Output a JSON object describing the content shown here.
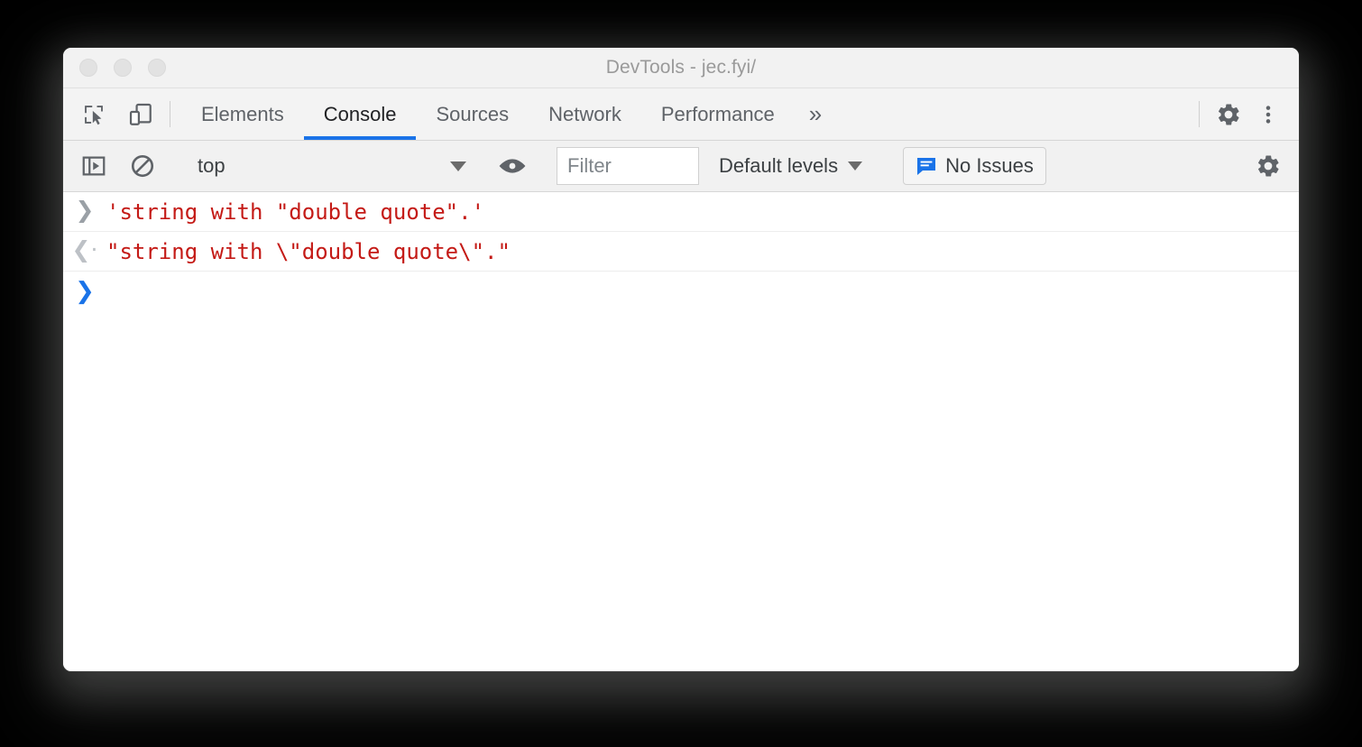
{
  "window": {
    "title": "DevTools - jec.fyi/",
    "traffic_lights": [
      "close",
      "minimize",
      "maximize"
    ]
  },
  "tabbar": {
    "left_icons": [
      {
        "name": "inspect-element-icon",
        "label": "Inspect element"
      },
      {
        "name": "device-toolbar-icon",
        "label": "Toggle device toolbar"
      }
    ],
    "tabs": [
      {
        "label": "Elements",
        "active": false
      },
      {
        "label": "Console",
        "active": true
      },
      {
        "label": "Sources",
        "active": false
      },
      {
        "label": "Network",
        "active": false
      },
      {
        "label": "Performance",
        "active": false
      }
    ],
    "more_tabs_glyph": "»",
    "right_icons": [
      {
        "name": "settings-gear-icon",
        "label": "Settings"
      },
      {
        "name": "more-options-icon",
        "label": "Customize and control DevTools"
      }
    ],
    "active_tab_color": "#1a73e8"
  },
  "console_toolbar": {
    "sidebar_toggle_label": "Show console sidebar",
    "clear_console_label": "Clear console",
    "context": {
      "selected": "top",
      "options": [
        "top"
      ]
    },
    "eye_icon_label": "Create live expression",
    "filter": {
      "value": "",
      "placeholder": "Filter"
    },
    "levels": {
      "selected": "Default levels",
      "caret": "▼"
    },
    "issues": {
      "label": "No Issues",
      "icon": "issues-speech-bubble-icon",
      "icon_color": "#1a73e8"
    },
    "settings_label": "Console settings"
  },
  "console": {
    "text_color": "#c41a16",
    "prompt_color": "#1a73e8",
    "entries": [
      {
        "type": "input",
        "gutter_glyph": "❯",
        "text": "'string with \"double quote\".'"
      },
      {
        "type": "result",
        "gutter_glyph": "❮·",
        "text": "\"string with \\\"double quote\\\".\""
      }
    ],
    "prompt": {
      "glyph": "❯",
      "value": ""
    }
  }
}
